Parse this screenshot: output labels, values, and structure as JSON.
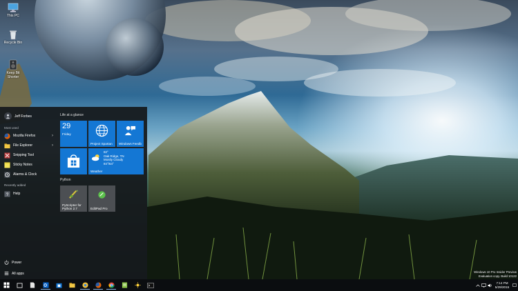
{
  "desktop": {
    "icons": [
      {
        "label": "This PC",
        "icon": "computer-icon"
      },
      {
        "label": "Recycle Bin",
        "icon": "recycle-bin-icon"
      },
      {
        "label": "Keep Bit Shorter",
        "icon": "speaker-icon"
      }
    ]
  },
  "start_menu": {
    "user_name": "Jeff Forbes",
    "most_used_label": "Most used",
    "most_used": [
      {
        "label": "Mozilla Firefox",
        "icon": "firefox-icon",
        "color": "#e66000",
        "has_submenu": true
      },
      {
        "label": "File Explorer",
        "icon": "folder-icon",
        "color": "#f2c744",
        "has_submenu": true
      },
      {
        "label": "Snipping Tool",
        "icon": "scissors-icon",
        "color": "#d44f4f",
        "has_submenu": false
      },
      {
        "label": "Sticky Notes",
        "icon": "sticky-note-icon",
        "color": "#f3e35a",
        "has_submenu": false
      },
      {
        "label": "Alarms & Clock",
        "icon": "clock-icon",
        "color": "#6f7880",
        "has_submenu": false
      }
    ],
    "recently_added_label": "Recently added",
    "recently_added": [
      {
        "label": "Help",
        "icon": "help-icon",
        "color": "#2c5aa0"
      }
    ],
    "power_label": "Power",
    "all_apps_label": "All apps",
    "groups": [
      {
        "label": "Life at a glance"
      },
      {
        "label": "Python"
      }
    ],
    "tiles": {
      "calendar": {
        "day": "29",
        "weekday": "Friday"
      },
      "spartan": {
        "label": "Project Spartan"
      },
      "feeds": {
        "label": "Windows Feedb"
      },
      "store": {
        "label": ""
      },
      "weather": {
        "temp": "82°",
        "location": "Oak Ridge, TN",
        "condition": "Mostly Cloudy",
        "range": "84°/64°",
        "label": "Weather"
      },
      "pyscripter": {
        "label": "PyScripter for Python 2.7"
      },
      "editpad": {
        "label": "EditPad Pro"
      }
    }
  },
  "taskbar": {
    "buttons": [
      "start-icon",
      "task-view-icon",
      "file-icon",
      "outlook-icon",
      "store-icon",
      "explorer-icon",
      "chrome-alt-icon",
      "firefox-icon",
      "chrome-icon",
      "notepad-icon",
      "sun-icon",
      "terminal-icon"
    ],
    "time": "7:14 PM",
    "date": "5/29/2015"
  },
  "watermark": {
    "line1": "Windows 10 Pro Insider Preview",
    "line2": "Evaluation copy. Build 10122"
  },
  "colors": {
    "tile_blue": "#1477d4",
    "start_bg": "#16191e",
    "taskbar_bg": "#0b0d10"
  }
}
